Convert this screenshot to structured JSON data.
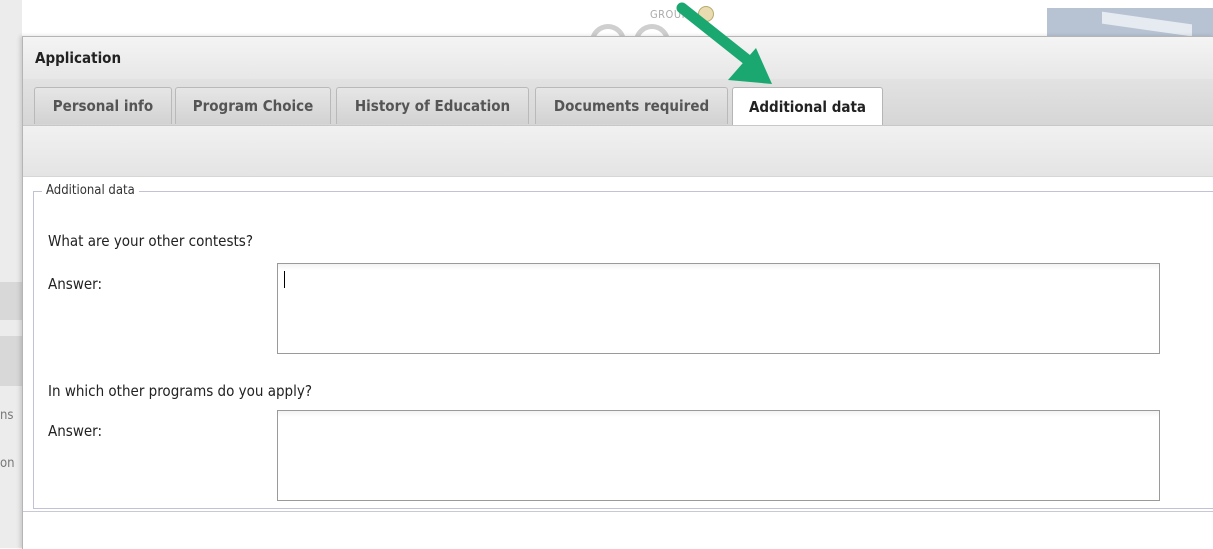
{
  "background": {
    "logo_text": "GROUP",
    "left_text_1": "ns",
    "left_text_2": "on"
  },
  "dialog": {
    "title": "Application",
    "tabs": [
      {
        "label": "Personal info",
        "active": false
      },
      {
        "label": "Program Choice",
        "active": false
      },
      {
        "label": "History of Education",
        "active": false
      },
      {
        "label": "Documents required",
        "active": false
      },
      {
        "label": "Additional data",
        "active": true
      }
    ]
  },
  "section": {
    "legend": "Additional data",
    "questions": [
      {
        "question": "What are your other contests?",
        "answer_label": "Answer:",
        "answer_value": ""
      },
      {
        "question": "In which other programs do you apply?",
        "answer_label": "Answer:",
        "answer_value": ""
      }
    ]
  },
  "annotation": {
    "arrow_color": "#1aa870",
    "arrow_target": "Additional data tab"
  }
}
